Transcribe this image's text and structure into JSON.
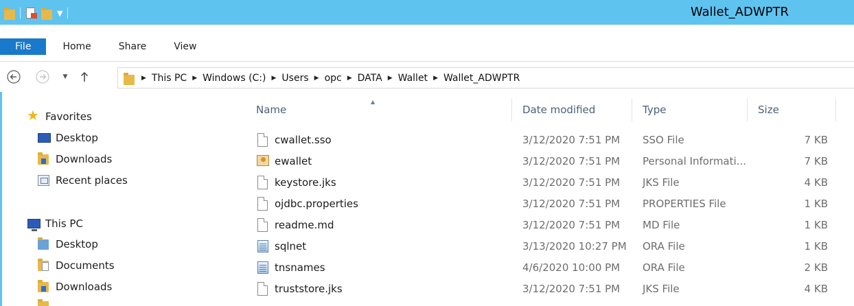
{
  "window": {
    "title": "Wallet_ADWPTR",
    "accent": "#5fc3f0",
    "file_tab_color": "#1979ca"
  },
  "ribbon": {
    "tabs": [
      "File",
      "Home",
      "Share",
      "View"
    ]
  },
  "address": {
    "crumbs": [
      "This PC",
      "Windows (C:)",
      "Users",
      "opc",
      "DATA",
      "Wallet",
      "Wallet_ADWPTR"
    ]
  },
  "nav": {
    "favorites_label": "Favorites",
    "favorites": [
      {
        "label": "Desktop",
        "icon": "desktop-icon"
      },
      {
        "label": "Downloads",
        "icon": "downloads-folder-icon"
      },
      {
        "label": "Recent places",
        "icon": "recent-places-icon"
      }
    ],
    "thispc_label": "This PC",
    "thispc": [
      {
        "label": "Desktop",
        "icon": "desktop-folder-icon"
      },
      {
        "label": "Documents",
        "icon": "documents-folder-icon"
      },
      {
        "label": "Downloads",
        "icon": "downloads-folder-icon"
      }
    ]
  },
  "columns": {
    "name": "Name",
    "date": "Date modified",
    "type": "Type",
    "size": "Size"
  },
  "files": [
    {
      "name": "cwallet.sso",
      "date": "3/12/2020 7:51 PM",
      "type": "SSO File",
      "size": "7 KB",
      "icon": "file-icon"
    },
    {
      "name": "ewallet",
      "date": "3/12/2020 7:51 PM",
      "type": "Personal Informati...",
      "size": "7 KB",
      "icon": "certificate-icon"
    },
    {
      "name": "keystore.jks",
      "date": "3/12/2020 7:51 PM",
      "type": "JKS File",
      "size": "4 KB",
      "icon": "file-icon"
    },
    {
      "name": "ojdbc.properties",
      "date": "3/12/2020 7:51 PM",
      "type": "PROPERTIES File",
      "size": "1 KB",
      "icon": "file-icon"
    },
    {
      "name": "readme.md",
      "date": "3/12/2020 7:51 PM",
      "type": "MD File",
      "size": "1 KB",
      "icon": "file-icon"
    },
    {
      "name": "sqlnet",
      "date": "3/13/2020 10:27 PM",
      "type": "ORA File",
      "size": "1 KB",
      "icon": "ora-file-icon"
    },
    {
      "name": "tnsnames",
      "date": "4/6/2020 10:00 PM",
      "type": "ORA File",
      "size": "2 KB",
      "icon": "ora-file-icon"
    },
    {
      "name": "truststore.jks",
      "date": "3/12/2020 7:51 PM",
      "type": "JKS File",
      "size": "4 KB",
      "icon": "file-icon"
    }
  ]
}
